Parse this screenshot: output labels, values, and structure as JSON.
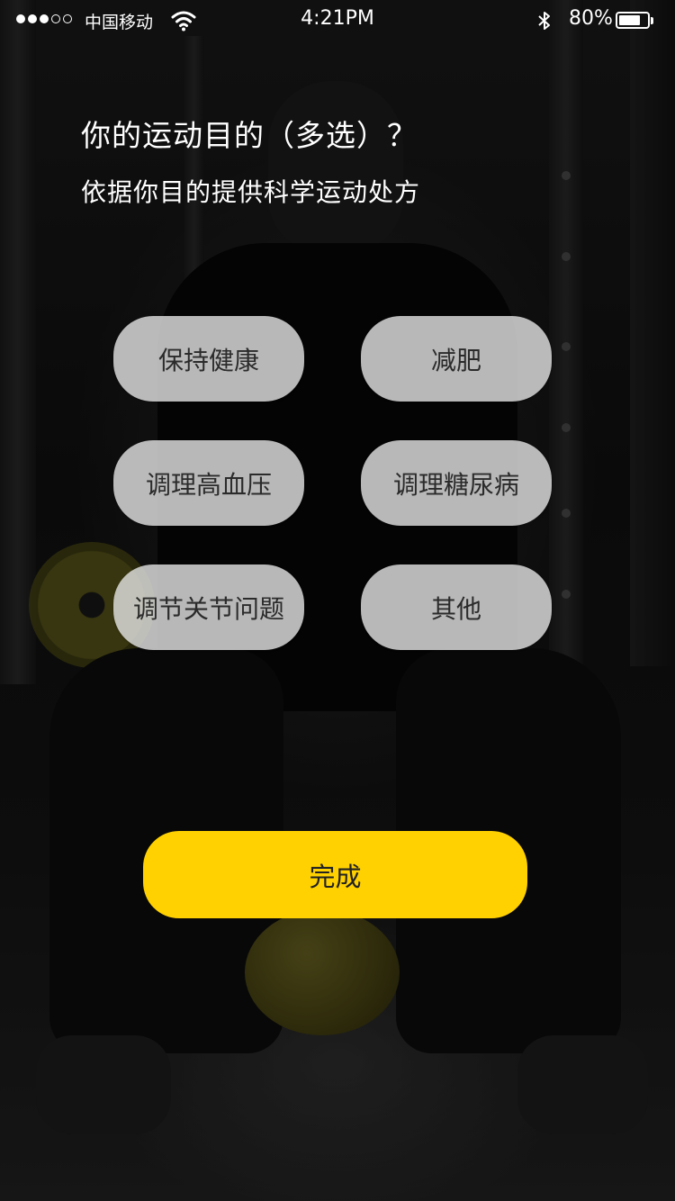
{
  "status_bar": {
    "carrier": "中国移动",
    "time": "4:21PM",
    "battery_percent": "80%",
    "battery_level": 0.8,
    "signal_icon": "signal-dots-icon",
    "wifi_icon": "wifi-icon",
    "bluetooth_icon": "bluetooth-icon"
  },
  "header": {
    "title": "你的运动目的（多选）？",
    "subtitle": "依据你目的提供科学运动处方"
  },
  "options": [
    {
      "label": "保持健康"
    },
    {
      "label": "减肥"
    },
    {
      "label": "调理高血压"
    },
    {
      "label": "调理糖尿病"
    },
    {
      "label": "调节关节问题"
    },
    {
      "label": "其他"
    }
  ],
  "actions": {
    "done_label": "完成"
  },
  "colors": {
    "accent": "#ffd100",
    "option_bg": "#e1e1e1",
    "text_light": "#ffffff",
    "text_dark": "#2b2b2b"
  }
}
